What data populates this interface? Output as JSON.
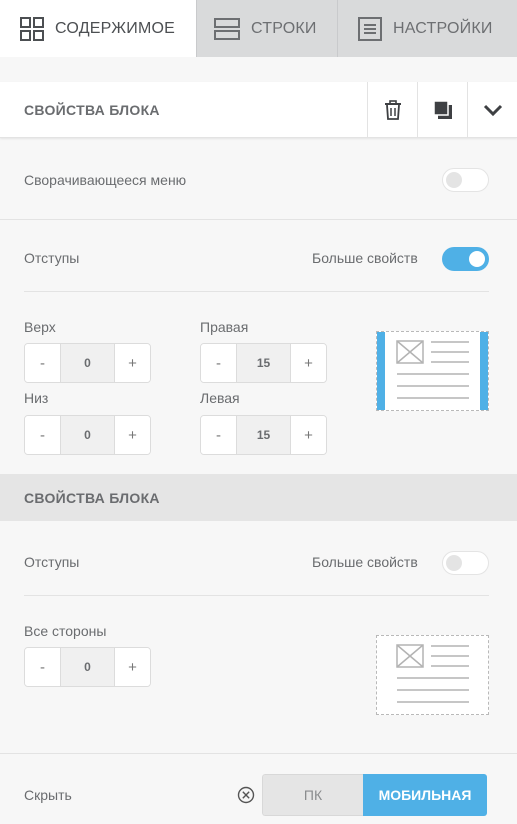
{
  "tabs": [
    {
      "label": "СОДЕРЖИМОЕ",
      "icon": "grid-icon",
      "active": true
    },
    {
      "label": "СТРОКИ",
      "icon": "rows-icon",
      "active": false
    },
    {
      "label": "НАСТРОЙКИ",
      "icon": "settings-list-icon",
      "active": false
    }
  ],
  "block1": {
    "title": "СВОЙСТВА БЛОКА",
    "actions": [
      "trash-icon",
      "duplicate-icon",
      "chevron-down-icon"
    ],
    "collapsible_menu": {
      "label": "Сворачивающееся меню",
      "enabled": false
    },
    "padding": {
      "label": "Отступы",
      "more_label": "Больше свойств",
      "more_enabled": true,
      "top": {
        "label": "Верх",
        "value": "0"
      },
      "right": {
        "label": "Правая",
        "value": "15"
      },
      "bottom": {
        "label": "Низ",
        "value": "0"
      },
      "left": {
        "label": "Левая",
        "value": "15"
      }
    }
  },
  "block2": {
    "title": "СВОЙСТВА БЛОКА",
    "padding": {
      "label": "Отступы",
      "more_label": "Больше свойств",
      "more_enabled": false,
      "all": {
        "label": "Все стороны",
        "value": "0"
      }
    }
  },
  "stepper": {
    "minus": "-",
    "plus": "+"
  },
  "hide": {
    "label": "Скрыть",
    "icon": "close-circle-icon",
    "options": [
      "ПК",
      "МОБИЛЬНАЯ"
    ],
    "selected": "МОБИЛЬНАЯ"
  },
  "colors": {
    "accent": "#4fb0e6",
    "tab_bg": "#d9dadb",
    "panel_bg": "#f7f7f7"
  }
}
